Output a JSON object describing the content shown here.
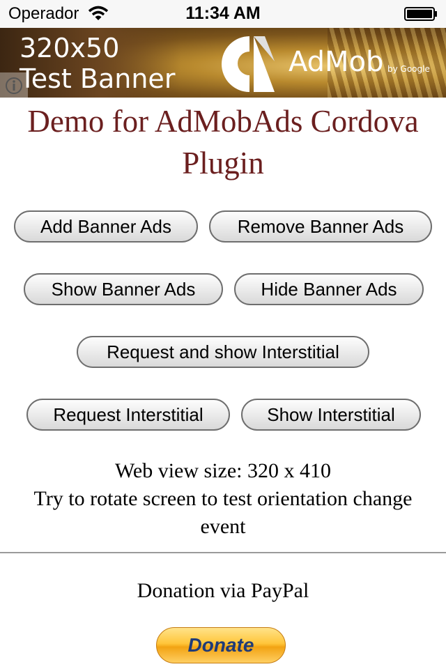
{
  "status_bar": {
    "carrier": "Operador",
    "time": "11:34 AM"
  },
  "banner": {
    "line1": "320x50",
    "line2": "Test Banner",
    "brand": "AdMob",
    "byline": "by Google"
  },
  "title": "Demo for AdMobAds Cordova Plugin",
  "buttons": {
    "add_banner": "Add Banner Ads",
    "remove_banner": "Remove Banner Ads",
    "show_banner": "Show Banner Ads",
    "hide_banner": "Hide Banner Ads",
    "request_show_interstitial": "Request and show Interstitial",
    "request_interstitial": "Request Interstitial",
    "show_interstitial": "Show Interstitial"
  },
  "info": {
    "webview_size": "Web view size: 320 x 410",
    "rotate_hint": "Try to rotate screen to test orientation change event"
  },
  "donation": {
    "label": "Donation via PayPal",
    "button": "Donate"
  }
}
